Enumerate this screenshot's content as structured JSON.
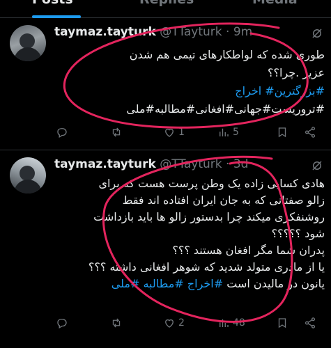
{
  "tabs": [
    {
      "label": "Posts",
      "active": true
    },
    {
      "label": "Replies",
      "active": false
    },
    {
      "label": "Media",
      "active": false
    }
  ],
  "tweets": [
    {
      "name": "taymaz.tayturk",
      "handle": "@TTayturk",
      "separator": "·",
      "time": "9m",
      "lines": [
        "طوری شده که لواطکارهای تیمی هم شدن",
        "عزیز .چرا؟؟",
        "#بزرگترین# اخراج",
        "#تروریست#جهانی#افغانی#مطالبه#ملی"
      ],
      "stats": {
        "replies": "",
        "reposts": "",
        "likes": "1",
        "views": "5"
      }
    },
    {
      "name": "taymaz.tayturk",
      "handle": "@TTayturk",
      "separator": "·",
      "time": "3d",
      "lines": [
        "هادی کسایی زاده یک وطن پرست هست که برای",
        "زالو صفتانی که به جان ایران افتاده اند فقط",
        "روشنفکری میکند چرا بدستور زالو ها باید بازداشت",
        "شود ؟؟؟؟؟",
        "پدران شما مگر افغان هستند ؟؟؟",
        "یا از مادری متولد شدید که شوهر افغانی داشته ؟؟؟",
        "یانون در مالیدن است ",
        "#اخراج #مطالبه #ملی"
      ],
      "stats": {
        "replies": "",
        "reposts": "",
        "likes": "2",
        "views": "48"
      }
    }
  ],
  "colors": {
    "accent": "#1d9bf0",
    "annotation": "#e3245d",
    "muted": "#71767b"
  },
  "icons": [
    "reply-icon",
    "repost-icon",
    "like-icon",
    "views-icon",
    "bookmark-icon",
    "share-icon",
    "grok-icon"
  ]
}
